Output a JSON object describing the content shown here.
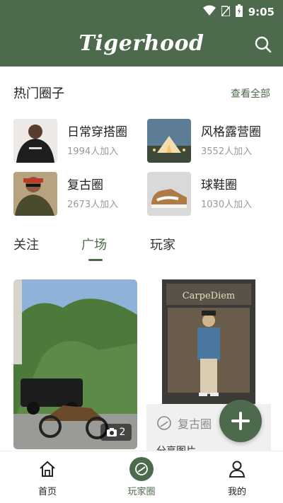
{
  "status_bar": {
    "time": "9:05",
    "icons": [
      "wifi-icon",
      "sim-icon",
      "battery-icon"
    ]
  },
  "app_bar": {
    "logo": "Tigerhood",
    "icon": "search-icon"
  },
  "hot_circles": {
    "title": "热门圈子",
    "view_all": "查看全部",
    "items": [
      {
        "name": "日常穿搭圈",
        "count": "1994人加入"
      },
      {
        "name": "风格露营圈",
        "count": "3552人加入"
      },
      {
        "name": "复古圈",
        "count": "2673人加入"
      },
      {
        "name": "球鞋圈",
        "count": "1030人加入"
      }
    ]
  },
  "tabs": {
    "items": [
      "关注",
      "广场",
      "玩家"
    ],
    "active_index": 1
  },
  "feed": {
    "left_card": {
      "photo_count": "2"
    },
    "right_card": {
      "tag": "复古圈",
      "title": "分享图片"
    }
  },
  "bottom_nav": {
    "items": [
      {
        "label": "首页",
        "icon": "home-icon"
      },
      {
        "label": "玩家圈",
        "icon": "chat-bubble-icon"
      },
      {
        "label": "我的",
        "icon": "person-icon"
      }
    ],
    "active_index": 1
  },
  "colors": {
    "brand": "#4e6a4d",
    "muted_text": "#9a9a9a",
    "card_bg": "#f0f0f0"
  }
}
